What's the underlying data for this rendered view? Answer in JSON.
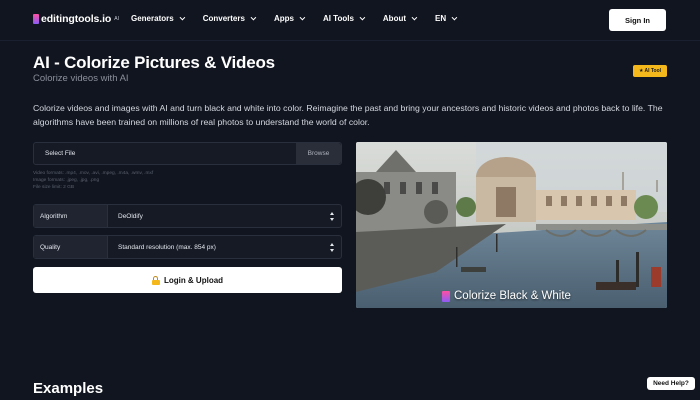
{
  "nav": {
    "logo_text": "editingtools.io",
    "logo_sup": "AI",
    "items": [
      {
        "label": "Generators"
      },
      {
        "label": "Converters"
      },
      {
        "label": "Apps"
      },
      {
        "label": "AI Tools"
      },
      {
        "label": "About"
      },
      {
        "label": "EN"
      }
    ],
    "signin_label": "Sign In"
  },
  "header": {
    "title": "AI - Colorize Pictures & Videos",
    "subtitle": "Colorize videos with AI",
    "badge": "AI Tool",
    "description": "Colorize videos and images with AI and turn black and white into color. Reimagine the past and bring your ancestors and historic videos and photos back to life. The algorithms have been trained on millions of real photos to understand the world of color."
  },
  "form": {
    "file_label": "Select File",
    "browse_label": "Browse",
    "video_formats": "Video formats: .mp4, .mov, .avi, .mpeg, .m4a, .wmv, .mxf",
    "image_formats": "Image formats: .jpeg, .jpg, .png",
    "size_limit": "File size limit: 2 GB",
    "algorithm": {
      "label": "Algorithm",
      "value": "DeOldify"
    },
    "quality": {
      "label": "Quality",
      "value": "Standard resolution (max. 854 px)"
    },
    "login_label": "Login & Upload"
  },
  "hero": {
    "caption": "Colorize Black & White"
  },
  "examples_heading": "Examples",
  "help_label": "Need Help?",
  "colors": {
    "background": "#11151f",
    "badge": "#f5b81c",
    "brand_pink": "#ff4fa3",
    "brand_purple": "#8b5cf6"
  }
}
